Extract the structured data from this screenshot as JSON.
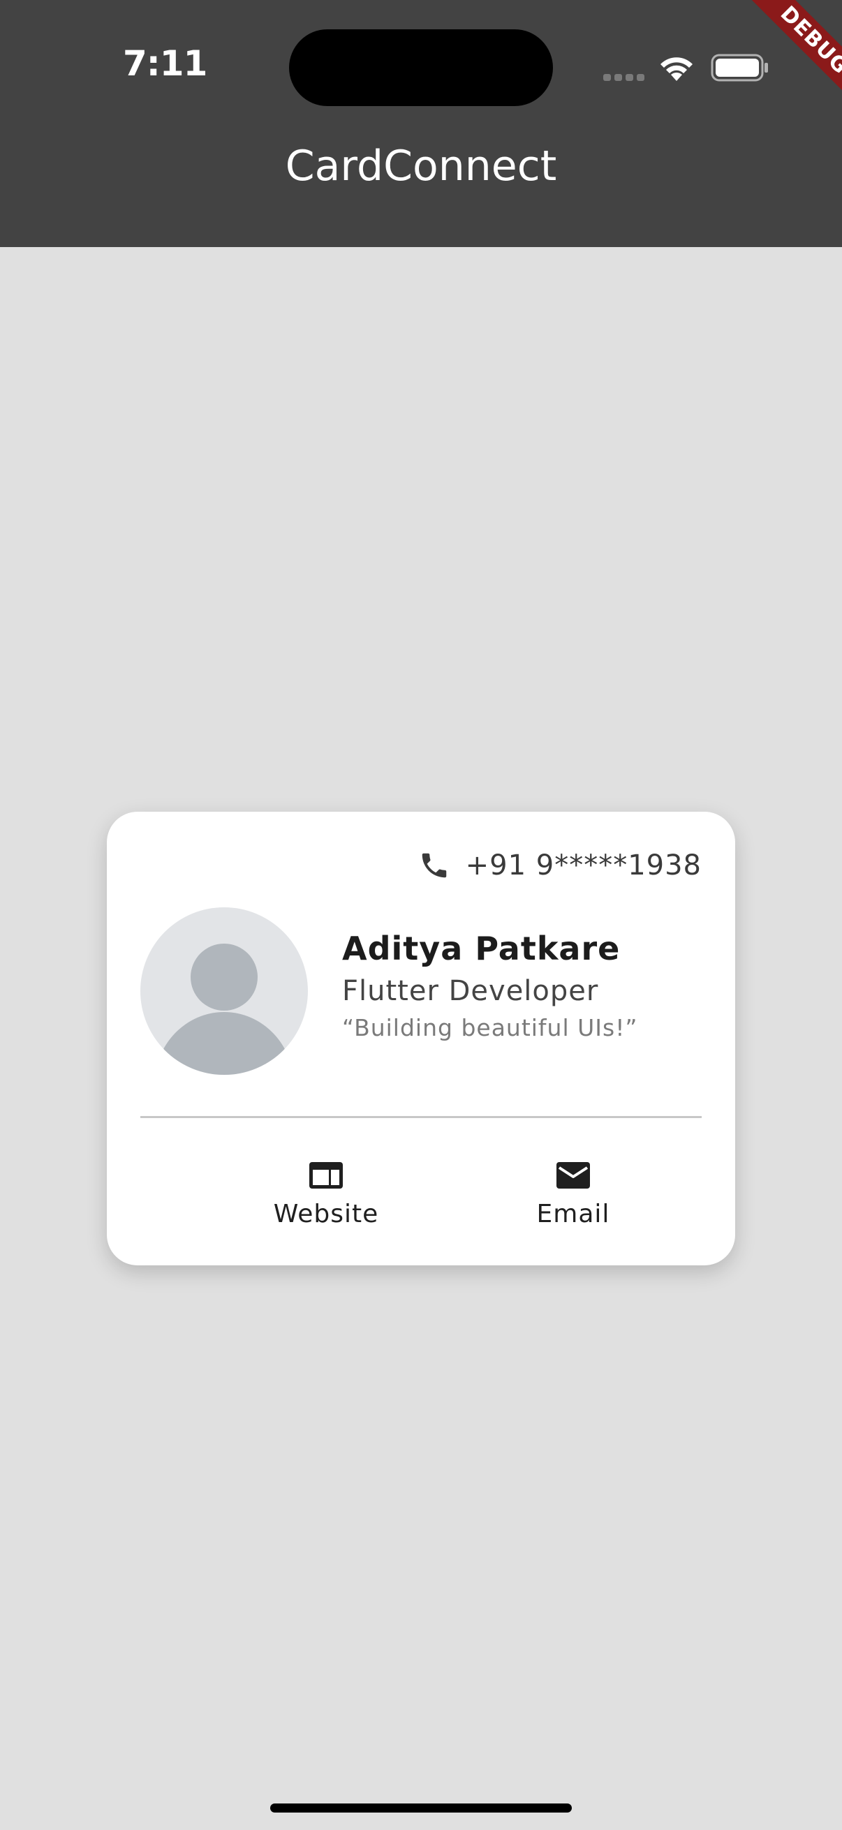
{
  "status_bar": {
    "time": "7:11",
    "icons": [
      "signal-icon",
      "wifi-icon",
      "battery-icon"
    ]
  },
  "app_bar": {
    "title": "CardConnect"
  },
  "debug_banner": {
    "label": "DEBUG",
    "color": "#8b1a1a"
  },
  "card": {
    "phone": {
      "icon": "phone-icon",
      "number": "+91 9*****1938"
    },
    "avatar": {
      "icon": "person-icon"
    },
    "name": "Aditya Patkare",
    "role": "Flutter Developer",
    "tagline": "“Building beautiful UIs!”",
    "actions": [
      {
        "label": "Website",
        "icon": "web-icon"
      },
      {
        "label": "Email",
        "icon": "email-icon"
      }
    ]
  },
  "colors": {
    "app_bar_bg": "#434343",
    "page_bg": "#e0e0e0",
    "card_bg": "#ffffff"
  }
}
